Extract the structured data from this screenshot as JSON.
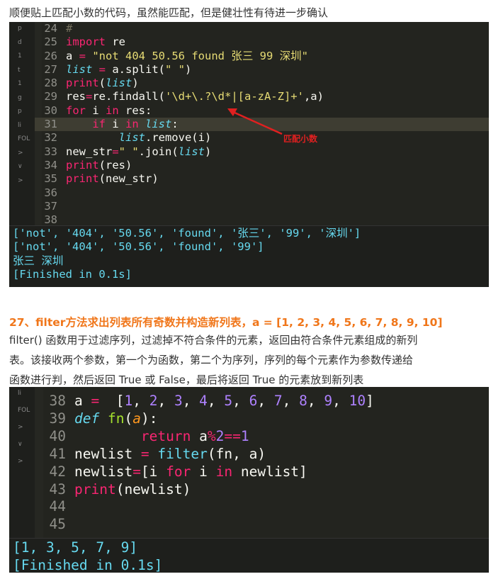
{
  "intro": "顺便贴上匹配小数的代码，虽然能匹配，但是健壮性有待进一步确认",
  "shot1": {
    "lines": [
      {
        "n": "24",
        "t": [
          [
            "#",
            "cm"
          ]
        ]
      },
      {
        "n": "25",
        "t": [
          [
            "import",
            "kw"
          ],
          [
            " re",
            "pl"
          ]
        ]
      },
      {
        "n": "26",
        "t": [
          [
            "a ",
            "pl"
          ],
          [
            "=",
            "kw"
          ],
          [
            " \"not 404 50.56 found 张三 99 深圳\"",
            "st"
          ]
        ]
      },
      {
        "n": "27",
        "t": [
          [
            "list",
            "it"
          ],
          [
            " ",
            "pl"
          ],
          [
            "=",
            "kw"
          ],
          [
            " a.split(",
            "pl"
          ],
          [
            "\" \"",
            "st"
          ],
          [
            ")",
            "pl"
          ]
        ]
      },
      {
        "n": "28",
        "t": [
          [
            "print",
            "kw"
          ],
          [
            "(",
            "pl"
          ],
          [
            "list",
            "it"
          ],
          [
            ")",
            "pl"
          ]
        ]
      },
      {
        "n": "29",
        "t": [
          [
            "res",
            "pl"
          ],
          [
            "=",
            "kw"
          ],
          [
            "re.findall(",
            "pl"
          ],
          [
            "'\\d+\\.?\\d*|[a-zA-Z]+'",
            "st"
          ],
          [
            ",a)",
            "pl"
          ]
        ]
      },
      {
        "n": "30",
        "t": [
          [
            "for",
            "kw"
          ],
          [
            " i ",
            "pl"
          ],
          [
            "in",
            "kw"
          ],
          [
            " res:",
            "pl"
          ]
        ]
      },
      {
        "n": "31",
        "t": [
          [
            "    ",
            "pl"
          ],
          [
            "if",
            "kw"
          ],
          [
            " i ",
            "pl"
          ],
          [
            "in",
            "kw"
          ],
          [
            " ",
            "pl"
          ],
          [
            "list",
            "it"
          ],
          [
            ":",
            "pl"
          ]
        ],
        "current": true
      },
      {
        "n": "32",
        "t": [
          [
            "        ",
            "pl"
          ],
          [
            "list",
            "it"
          ],
          [
            ".remove(i)",
            "pl"
          ]
        ]
      },
      {
        "n": "33",
        "t": [
          [
            "new_str",
            "pl"
          ],
          [
            "=",
            "kw"
          ],
          [
            "\" \"",
            "st"
          ],
          [
            ".join(",
            "pl"
          ],
          [
            "list",
            "it"
          ],
          [
            ")",
            "pl"
          ]
        ]
      },
      {
        "n": "34",
        "t": [
          [
            "print",
            "kw"
          ],
          [
            "(res)",
            "pl"
          ]
        ]
      },
      {
        "n": "35",
        "t": [
          [
            "print",
            "kw"
          ],
          [
            "(new_str)",
            "pl"
          ]
        ]
      },
      {
        "n": "36",
        "t": []
      },
      {
        "n": "37",
        "t": []
      },
      {
        "n": "38",
        "t": []
      }
    ],
    "annotation": "匹配小数",
    "output": [
      "['not', '404', '50.56', 'found', '张三', '99', '深圳']",
      "['not', '404', '50.56', 'found', '99']",
      "张三 深圳",
      "[Finished in 0.1s]"
    ],
    "sidebar": [
      "p",
      "d",
      "1",
      "t",
      "1",
      "g",
      "p",
      "li",
      "FOL",
      ">",
      "∨",
      ">"
    ]
  },
  "heading": "27、filter方法求出列表所有奇数并构造新列表，a =  [1, 2, 3, 4, 5, 6, 7, 8, 9, 10]",
  "para": [
    "filter() 函数用于过滤序列，过滤掉不符合条件的元素，返回由符合条件元素组成的新列",
    "表。该接收两个参数，第一个为函数，第二个为序列，序列的每个元素作为参数传递给",
    "函数进行判，然后返回 True 或 False，最后将返回 True 的元素放到新列表"
  ],
  "shot2": {
    "lines": [
      {
        "n": "38",
        "t": [
          [
            "a ",
            "pl"
          ],
          [
            "=",
            "kw"
          ],
          [
            "  [",
            "pl"
          ],
          [
            "1",
            "nu"
          ],
          [
            ", ",
            "pl"
          ],
          [
            "2",
            "nu"
          ],
          [
            ", ",
            "pl"
          ],
          [
            "3",
            "nu"
          ],
          [
            ", ",
            "pl"
          ],
          [
            "4",
            "nu"
          ],
          [
            ", ",
            "pl"
          ],
          [
            "5",
            "nu"
          ],
          [
            ", ",
            "pl"
          ],
          [
            "6",
            "nu"
          ],
          [
            ", ",
            "pl"
          ],
          [
            "7",
            "nu"
          ],
          [
            ", ",
            "pl"
          ],
          [
            "8",
            "nu"
          ],
          [
            ", ",
            "pl"
          ],
          [
            "9",
            "nu"
          ],
          [
            ", ",
            "pl"
          ],
          [
            "10",
            "nu"
          ],
          [
            "]",
            "pl"
          ]
        ]
      },
      {
        "n": "39",
        "t": [
          [
            "def",
            "it"
          ],
          [
            " ",
            "pl"
          ],
          [
            "fn",
            "gr"
          ],
          [
            "(",
            "pl"
          ],
          [
            "a",
            "pa"
          ],
          [
            "):",
            "pl"
          ]
        ]
      },
      {
        "n": "40",
        "t": [
          [
            "        ",
            "pl"
          ],
          [
            "return",
            "kw"
          ],
          [
            " a",
            "pl"
          ],
          [
            "%",
            "kw"
          ],
          [
            "2",
            "nu"
          ],
          [
            "==",
            "kw"
          ],
          [
            "1",
            "nu"
          ]
        ]
      },
      {
        "n": "41",
        "t": [
          [
            "newlist ",
            "pl"
          ],
          [
            "=",
            "kw"
          ],
          [
            " ",
            "pl"
          ],
          [
            "filter",
            "fn"
          ],
          [
            "(fn, a)",
            "pl"
          ]
        ]
      },
      {
        "n": "42",
        "t": [
          [
            "newlist",
            "pl"
          ],
          [
            "=",
            "kw"
          ],
          [
            "[i ",
            "pl"
          ],
          [
            "for",
            "kw"
          ],
          [
            " i ",
            "pl"
          ],
          [
            "in",
            "kw"
          ],
          [
            " newlist]",
            "pl"
          ]
        ]
      },
      {
        "n": "43",
        "t": [
          [
            "print",
            "kw"
          ],
          [
            "(newlist)",
            "pl"
          ]
        ]
      },
      {
        "n": "44",
        "t": []
      },
      {
        "n": "45",
        "t": []
      }
    ],
    "output": [
      "[1, 3, 5, 7, 9]",
      "[Finished in 0.1s]"
    ],
    "sidebar": [
      "li",
      "FOL",
      ">",
      "∨",
      ">"
    ]
  }
}
